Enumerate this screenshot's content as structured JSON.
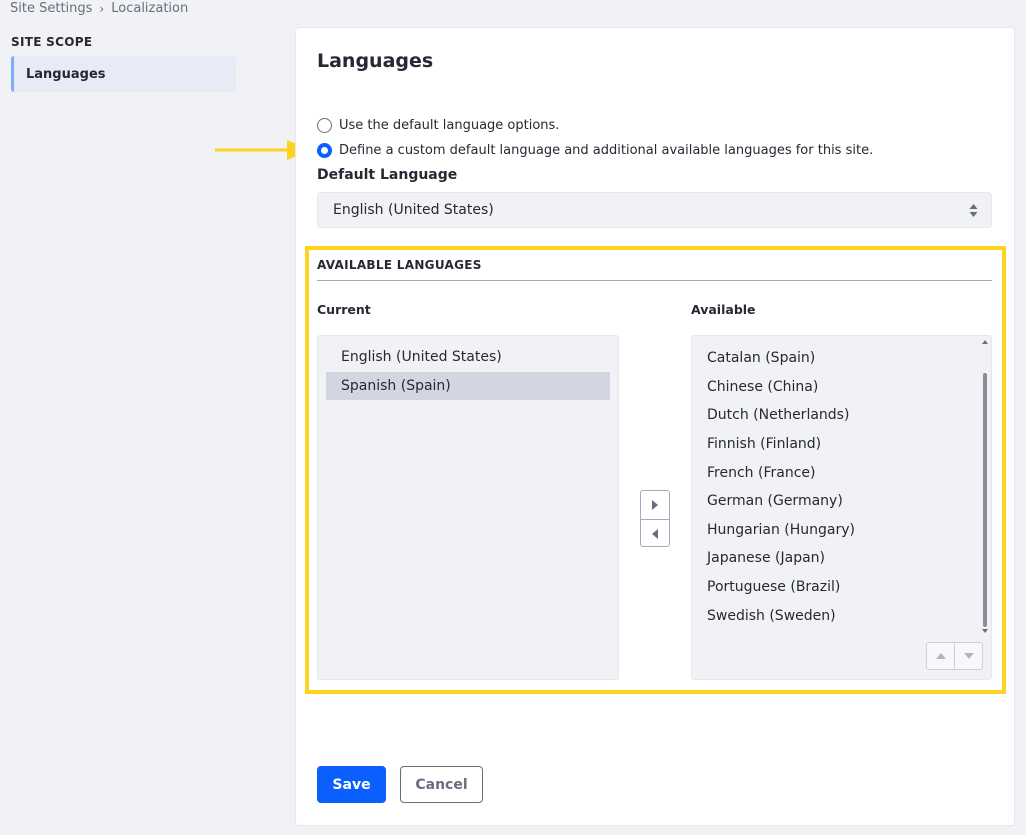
{
  "breadcrumb": {
    "items": [
      "Site Settings",
      "Localization"
    ],
    "separator": "›"
  },
  "sidebar": {
    "section_title": "SITE SCOPE",
    "items": [
      {
        "label": "Languages",
        "active": true
      }
    ]
  },
  "main": {
    "title": "Languages",
    "radio_options": [
      {
        "label": "Use the default language options.",
        "checked": false
      },
      {
        "label": "Define a custom default language and additional available languages for this site.",
        "checked": true
      }
    ],
    "default_language": {
      "label": "Default Language",
      "value": "English (United States)"
    },
    "available_languages": {
      "section_title": "AVAILABLE LANGUAGES",
      "current": {
        "label": "Current",
        "items": [
          "English (United States)",
          "Spanish (Spain)"
        ],
        "selected": "Spanish (Spain)"
      },
      "available": {
        "label": "Available",
        "items": [
          "Catalan (Spain)",
          "Chinese (China)",
          "Dutch (Netherlands)",
          "Finnish (Finland)",
          "French (France)",
          "German (Germany)",
          "Hungarian (Hungary)",
          "Japanese (Japan)",
          "Portuguese (Brazil)",
          "Swedish (Sweden)"
        ]
      }
    }
  },
  "actions": {
    "save_label": "Save",
    "cancel_label": "Cancel"
  },
  "colors": {
    "primary": "#0b5fff",
    "highlight": "#ffd21f",
    "arrow": "#ffd21f",
    "sidebar_active_bg": "#e6ebf5",
    "sidebar_active_border": "#80acff"
  },
  "icons": [
    "arrow-right-icon",
    "caret-up-down-icon",
    "move-right-icon",
    "move-left-icon",
    "scroll-up-icon",
    "scroll-down-icon",
    "reorder-up-icon",
    "reorder-down-icon"
  ]
}
